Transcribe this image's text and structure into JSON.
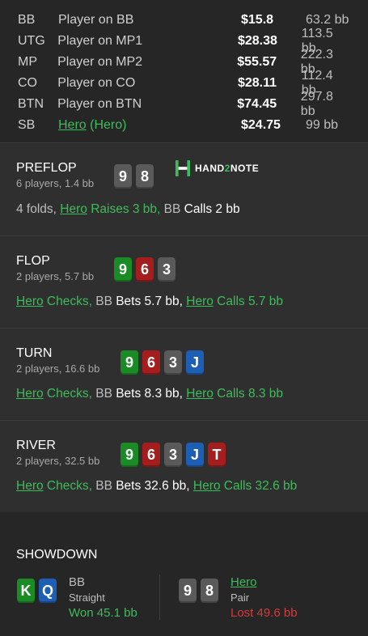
{
  "players": [
    {
      "pos": "BB",
      "name": "Player on BB",
      "stack": "$15.8",
      "bb": "63.2 bb"
    },
    {
      "pos": "UTG",
      "name": "Player on MP1",
      "stack": "$28.38",
      "bb": "113.5 bb"
    },
    {
      "pos": "MP",
      "name": "Player on MP2",
      "stack": "$55.57",
      "bb": "222.3 bb"
    },
    {
      "pos": "CO",
      "name": "Player on CO",
      "stack": "$28.11",
      "bb": "112.4 bb"
    },
    {
      "pos": "BTN",
      "name": "Player on BTN",
      "stack": "$74.45",
      "bb": "297.8 bb"
    },
    {
      "pos": "SB",
      "name": "Hero",
      "name_suffix": "(Hero)",
      "stack": "$24.75",
      "bb": "99 bb"
    }
  ],
  "logo": {
    "text_a": "HAND",
    "text_b": "2",
    "text_c": "NOTE"
  },
  "preflop": {
    "title": "PREFLOP",
    "sub": "6 players, 1.4 bb",
    "cards": [
      {
        "rank": "9",
        "suit": "spade"
      },
      {
        "rank": "8",
        "suit": "spade"
      }
    ],
    "action": {
      "p1": "4 folds, ",
      "hero": "Hero",
      "a1": " Raises 3 bb,",
      "p2": " BB ",
      "a2": "Calls 2 bb"
    }
  },
  "flop": {
    "title": "FLOP",
    "sub": "2 players, 5.7 bb",
    "cards": [
      {
        "rank": "9",
        "suit": "club"
      },
      {
        "rank": "6",
        "suit": "heart"
      },
      {
        "rank": "3",
        "suit": "spade"
      }
    ],
    "action": {
      "hero1": "Hero",
      "a1": " Checks,",
      "p2": " BB ",
      "a2": "Bets 5.7 bb,",
      "hero2": "Hero",
      "a3": " Calls 5.7 bb"
    }
  },
  "turn": {
    "title": "TURN",
    "sub": "2 players, 16.6 bb",
    "cards": [
      {
        "rank": "9",
        "suit": "club"
      },
      {
        "rank": "6",
        "suit": "heart"
      },
      {
        "rank": "3",
        "suit": "spade"
      },
      {
        "rank": "J",
        "suit": "diamond"
      }
    ],
    "action": {
      "hero1": "Hero",
      "a1": " Checks,",
      "p2": " BB ",
      "a2": "Bets 8.3 bb,",
      "hero2": "Hero",
      "a3": " Calls 8.3 bb"
    }
  },
  "river": {
    "title": "RIVER",
    "sub": "2 players, 32.5 bb",
    "cards": [
      {
        "rank": "9",
        "suit": "club"
      },
      {
        "rank": "6",
        "suit": "heart"
      },
      {
        "rank": "3",
        "suit": "spade"
      },
      {
        "rank": "J",
        "suit": "diamond"
      },
      {
        "rank": "T",
        "suit": "heart"
      }
    ],
    "action": {
      "hero1": "Hero",
      "a1": " Checks,",
      "p2": " BB ",
      "a2": "Bets 32.6 bb,",
      "hero2": "Hero",
      "a3": " Calls 32.6 bb"
    }
  },
  "showdown": {
    "title": "SHOWDOWN",
    "p1": {
      "name": "BB",
      "hand": "Straight",
      "result": "Won 45.1 bb",
      "cards": [
        {
          "rank": "K",
          "suit": "club"
        },
        {
          "rank": "Q",
          "suit": "diamond"
        }
      ]
    },
    "p2": {
      "name": "Hero",
      "hand": "Pair",
      "result": "Lost 49.6 bb",
      "cards": [
        {
          "rank": "9",
          "suit": "spade"
        },
        {
          "rank": "8",
          "suit": "spade"
        }
      ]
    }
  },
  "colors": {
    "hero": "#3dbd5a",
    "club": "#1b8c25",
    "heart": "#a51e1e",
    "spade": "#5a5a5a",
    "diamond": "#1d5fb5",
    "lost": "#d63a3a"
  }
}
